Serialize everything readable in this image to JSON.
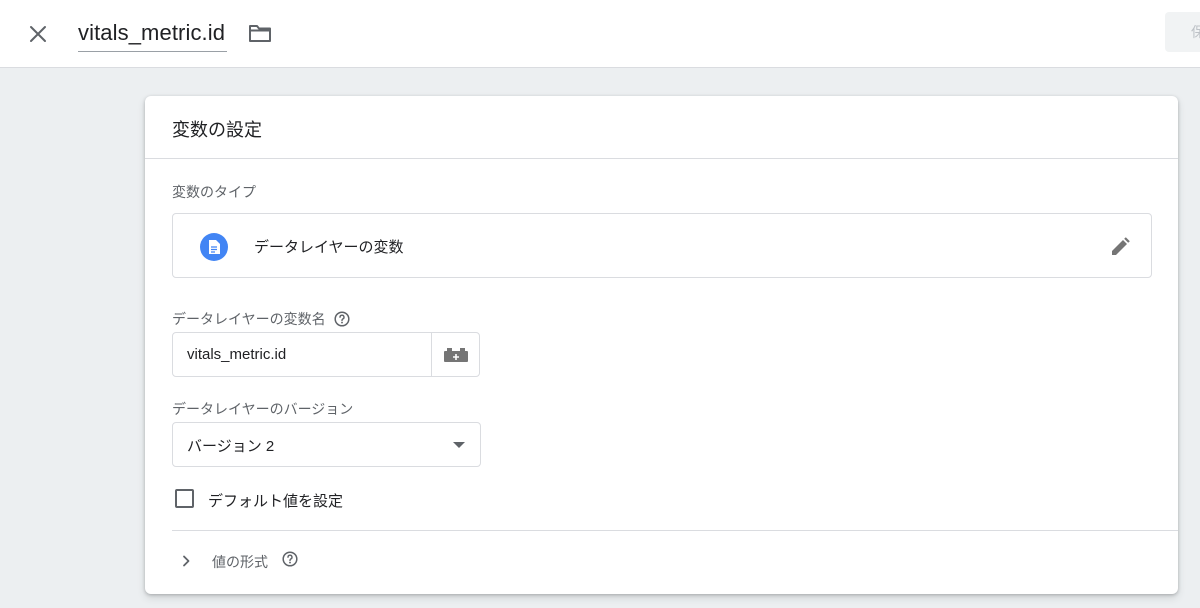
{
  "header": {
    "close_icon": "close-icon",
    "title": "vitals_metric.id",
    "folder_icon": "folder-icon",
    "save_label": "保存"
  },
  "card": {
    "title": "変数の設定",
    "type_section": {
      "label": "変数のタイプ",
      "type_name": "データレイヤーの変数",
      "type_icon": "document-icon",
      "edit_icon": "pencil-icon",
      "icon_color": "#4285f4"
    },
    "var_name": {
      "label": "データレイヤーの変数名",
      "value": "vitals_metric.id",
      "help_icon": "help-icon",
      "picker_icon": "variable-picker-icon"
    },
    "version": {
      "label": "データレイヤーのバージョン",
      "selected": "バージョン 2"
    },
    "default_value": {
      "label": "デフォルト値を設定",
      "checked": false
    },
    "format": {
      "label": "値の形式",
      "expanded": false
    }
  }
}
